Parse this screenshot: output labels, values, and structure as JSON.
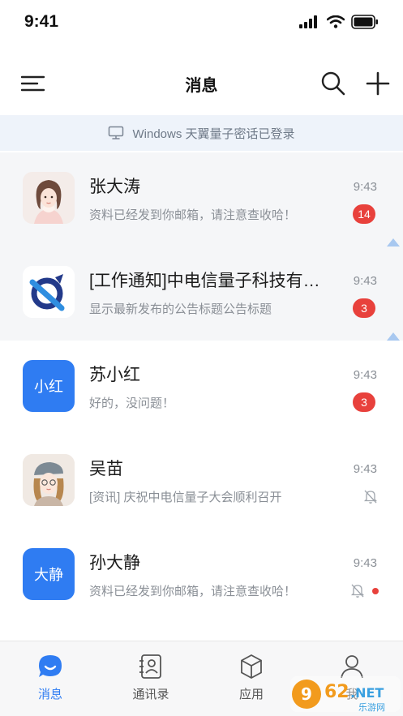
{
  "status_bar": {
    "time": "9:41",
    "icons": [
      "signal-icon",
      "wifi-icon",
      "battery-icon"
    ]
  },
  "nav": {
    "title": "消息",
    "left_icon": "menu-icon",
    "right_icons": [
      "search-icon",
      "plus-icon"
    ]
  },
  "banner": {
    "icon": "desktop-icon",
    "text": "Windows 天翼量子密话已登录"
  },
  "chats": [
    {
      "name": "张大涛",
      "preview": "资料已经发到你邮箱，请注意查收哈！",
      "time": "9:43",
      "badge": "14",
      "avatar": "woman-portrait",
      "pinned": true
    },
    {
      "name": "[工作通知]中电信量子科技有…",
      "preview": "显示最新发布的公告标题公告标题",
      "time": "9:43",
      "badge": "3",
      "avatar": "quantum-logo",
      "pinned": true
    },
    {
      "name": "苏小红",
      "preview": "好的，没问题！",
      "time": "9:43",
      "badge": "3",
      "avatar_text": "小红",
      "pinned": false
    },
    {
      "name": "吴苗",
      "preview": "[资讯] 庆祝中电信量子大会顺利召开",
      "time": "9:43",
      "badge": "",
      "muted": true,
      "avatar": "girl-portrait",
      "pinned": false
    },
    {
      "name": "孙大静",
      "preview": "资料已经发到你邮箱，请注意查收哈！",
      "time": "9:43",
      "badge": "",
      "muted": true,
      "unread_dot": true,
      "avatar_text": "大静",
      "pinned": false
    }
  ],
  "tabs": [
    {
      "label": "消息",
      "icon": "chat-bubble-icon",
      "active": true
    },
    {
      "label": "通讯录",
      "icon": "contacts-icon",
      "active": false
    },
    {
      "label": "应用",
      "icon": "cube-icon",
      "active": false
    },
    {
      "label": "我",
      "icon": "person-icon",
      "active": false
    }
  ],
  "watermark": {
    "brand": "962.NET",
    "sub": "乐游网"
  },
  "colors": {
    "accent": "#2f7cf2",
    "badge": "#e8413c",
    "banner_bg": "#eef3fa",
    "pinned_bg": "#f5f6f8"
  }
}
